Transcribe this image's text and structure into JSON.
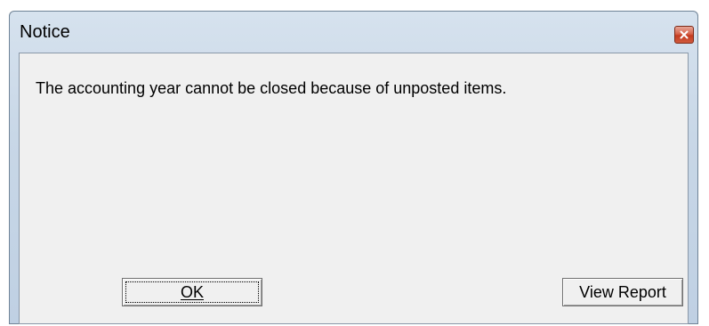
{
  "window": {
    "title": "Notice"
  },
  "dialog": {
    "message": "The accounting year cannot be closed because of unposted items.",
    "ok_label": "OK",
    "view_report_label": "View Report"
  },
  "icons": {
    "close": "close-icon"
  },
  "colors": {
    "close_button": "#c43b1f",
    "client_background": "#f0f0f0",
    "frame": "#c8d7e7"
  }
}
